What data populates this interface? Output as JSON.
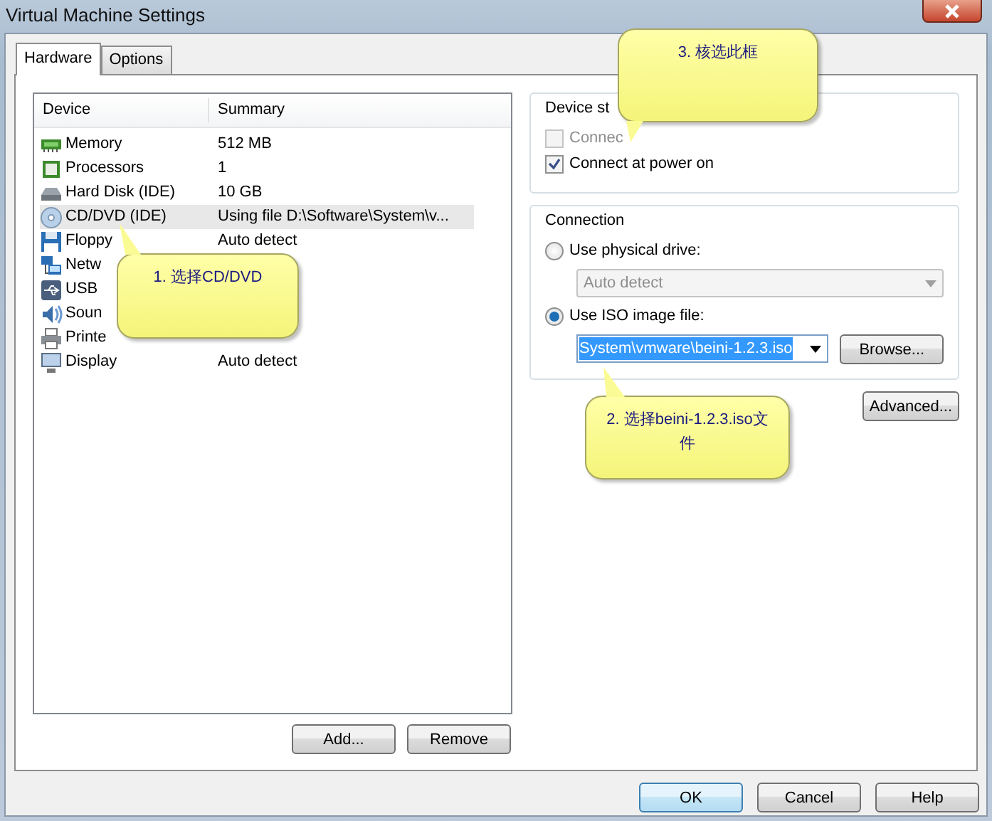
{
  "window": {
    "title": "Virtual Machine Settings"
  },
  "tabs": [
    {
      "label": "Hardware",
      "selected": true
    },
    {
      "label": "Options",
      "selected": false
    }
  ],
  "devices": {
    "columns": [
      "Device",
      "Summary"
    ],
    "rows": [
      {
        "device": "Memory",
        "summary": "512 MB",
        "selected": false
      },
      {
        "device": "Processors",
        "summary": "1",
        "selected": false
      },
      {
        "device": "Hard Disk (IDE)",
        "summary": "10 GB",
        "selected": false
      },
      {
        "device": "CD/DVD (IDE)",
        "summary": "Using file D:\\Software\\System\\v...",
        "selected": true
      },
      {
        "device": "Floppy",
        "summary": "Auto detect",
        "selected": false
      },
      {
        "device": "Netw",
        "selected": false
      },
      {
        "device": "USB",
        "selected": false
      },
      {
        "device": "Soun",
        "selected": false
      },
      {
        "device": "Printe",
        "selected": false
      },
      {
        "device": "Display",
        "summary": "Auto detect",
        "selected": false
      }
    ]
  },
  "list_buttons": [
    "Add...",
    "Remove"
  ],
  "device_status": {
    "title": "Device st",
    "options": [
      {
        "label": "Connec",
        "checked": false,
        "disabled": true
      },
      {
        "label": "Connect at power on",
        "checked": true,
        "disabled": false
      }
    ]
  },
  "connection": {
    "title": "Connection",
    "physical": {
      "label": "Use physical drive:",
      "selected": false,
      "dropdown": "Auto detect",
      "disabled": true
    },
    "iso": {
      "label": "Use ISO image file:",
      "selected": true,
      "value": "System\\vmware\\beini-1.2.3.iso",
      "browse": "Browse..."
    }
  },
  "advanced_button": "Advanced...",
  "callouts": [
    "3. 核选此框",
    "1. 选择CD/DVD",
    "2. 选择beini-1.2.3.iso文件"
  ],
  "footer_buttons": [
    {
      "label": "OK",
      "default": true
    },
    {
      "label": "Cancel",
      "default": false
    },
    {
      "label": "Help",
      "default": false
    }
  ]
}
